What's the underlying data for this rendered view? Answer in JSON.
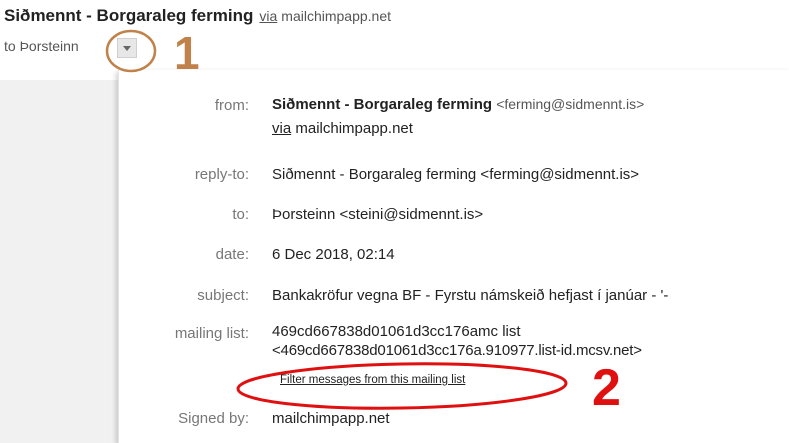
{
  "header": {
    "sender_name": "Siðmennt - Borgaraleg ferming",
    "via_prefix": "via",
    "via_domain": "mailchimpapp.net",
    "to_line": "to Þorsteinn"
  },
  "details": {
    "from": {
      "label": "from:",
      "name": "Siðmennt - Borgaraleg ferming",
      "email": "<ferming@sidmennt.is>",
      "via_prefix": "via",
      "via_domain": "mailchimpapp.net"
    },
    "reply_to": {
      "label": "reply-to:",
      "value": "Siðmennt - Borgaraleg ferming <ferming@sidmennt.is>"
    },
    "to": {
      "label": "to:",
      "value": "Þorsteinn <steini@sidmennt.is>"
    },
    "date": {
      "label": "date:",
      "value": "6 Dec 2018, 02:14"
    },
    "subject": {
      "label": "subject:",
      "value": "Bankakröfur vegna BF - Fyrstu námskeið hefjast í janúar - '-"
    },
    "mailing_list": {
      "label": "mailing list:",
      "line1": "469cd667838d01061d3cc176amc list",
      "line2": "<469cd667838d01061d3cc176a.910977.list-id.mcsv.net>",
      "filter_link": "Filter messages from this mailing list"
    },
    "signed_by": {
      "label": "Signed by:",
      "value": "mailchimpapp.net"
    }
  },
  "annotations": {
    "one": "1",
    "two": "2",
    "color_one": "#c0824a",
    "color_two": "#e01010"
  }
}
